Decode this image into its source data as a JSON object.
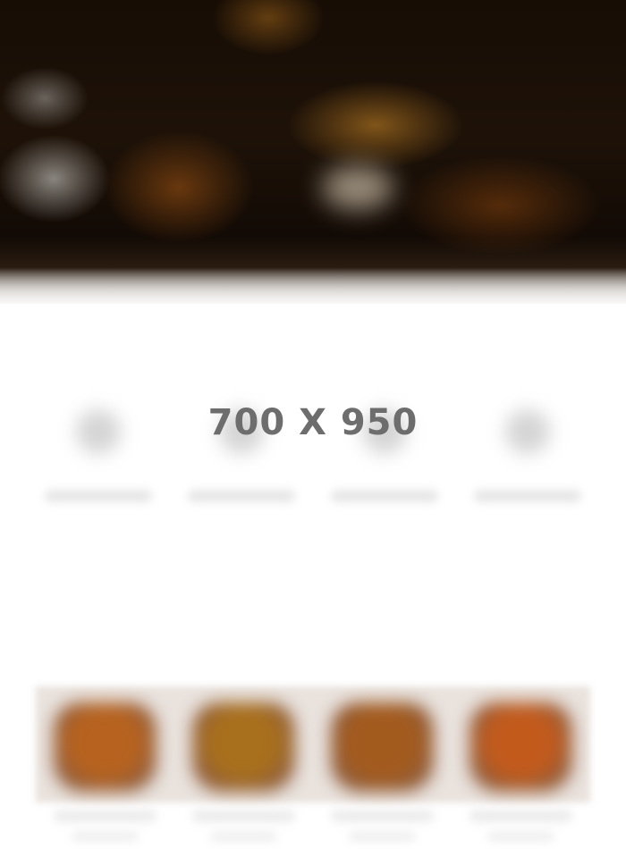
{
  "placeholder": {
    "label": "700 X 950"
  },
  "hero": {
    "heading": "",
    "subheading": "",
    "logo": ""
  },
  "features": {
    "title": "",
    "items": [
      {
        "icon": "feature-icon",
        "label": ""
      },
      {
        "icon": "feature-icon",
        "label": ""
      },
      {
        "icon": "feature-icon",
        "label": ""
      },
      {
        "icon": "feature-icon",
        "label": ""
      }
    ]
  },
  "products": {
    "title": "",
    "items": [
      {
        "name": "",
        "price": "",
        "color": "#b7621e"
      },
      {
        "name": "",
        "price": "",
        "color": "#a86f1c"
      },
      {
        "name": "",
        "price": "",
        "color": "#a35a1d"
      },
      {
        "name": "",
        "price": "",
        "color": "#c25a1c"
      }
    ]
  },
  "colors": {
    "hero_dark": "#170d05",
    "accent_amber": "#d28c28",
    "placeholder_text": "#6d6d6d"
  }
}
